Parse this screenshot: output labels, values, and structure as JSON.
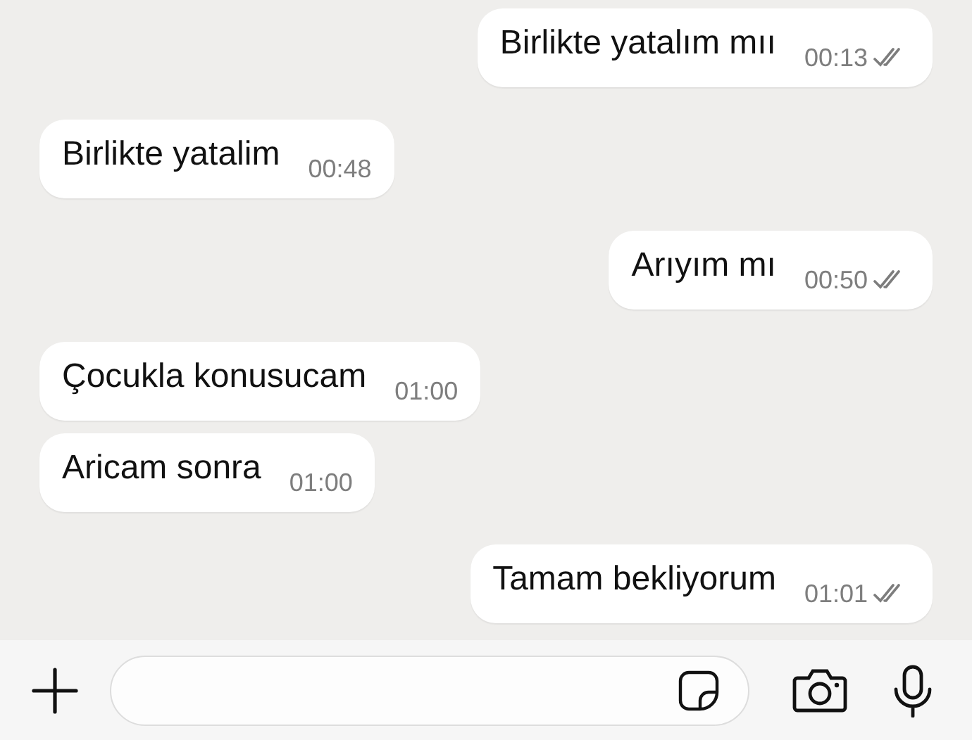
{
  "messages": [
    {
      "outgoing": true,
      "text": "Birlikte yatalım mıı",
      "time": "00:13",
      "read": false
    },
    {
      "outgoing": false,
      "text": "Birlikte yatalim",
      "time": "00:48"
    },
    {
      "outgoing": true,
      "text": "Arıyım mı",
      "time": "00:50",
      "read": false
    },
    {
      "outgoing": false,
      "text": "Çocukla konusucam",
      "time": "01:00"
    },
    {
      "outgoing": false,
      "text": "Aricam sonra",
      "time": "01:00"
    },
    {
      "outgoing": true,
      "text": "Tamam bekliyorum",
      "time": "01:01",
      "read": false
    }
  ]
}
